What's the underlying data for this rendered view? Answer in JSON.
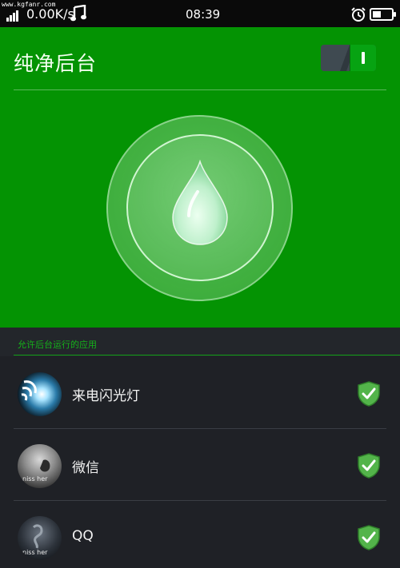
{
  "status_bar": {
    "watermark": "www.kgfanr.com",
    "net_speed": "0.00K/s",
    "time": "08:39",
    "icons": [
      "signal-icon",
      "music-note-icon",
      "alarm-clock-icon",
      "battery-icon"
    ]
  },
  "header": {
    "title": "纯净后台",
    "toggle_state": "on"
  },
  "main": {
    "section_label": "允许后台运行的应用",
    "apps": [
      {
        "name": "来电闪光灯",
        "checked": true
      },
      {
        "name": "微信",
        "checked": true,
        "avatar_caption": "niss her"
      },
      {
        "name": "QQ",
        "checked": true,
        "avatar_caption": "niss her"
      }
    ]
  },
  "colors": {
    "header_green": "#049303",
    "list_bg": "#1f2126",
    "accent_green": "#15b21a",
    "status_bar": "#0a0a0a"
  }
}
